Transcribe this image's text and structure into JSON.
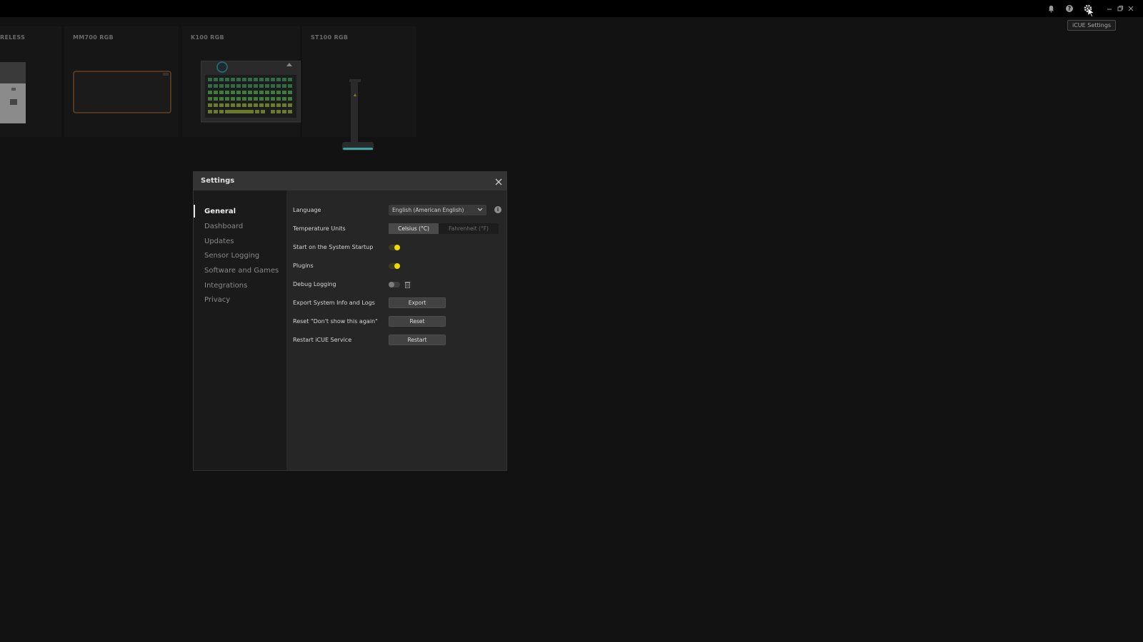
{
  "titlebar": {
    "icons": [
      "bell-icon",
      "help-icon",
      "gear-icon",
      "minimize-icon",
      "restore-icon",
      "close-icon"
    ],
    "tooltip": "iCUE Settings"
  },
  "devices": [
    {
      "name": "RELESS",
      "image": "headset-dongle"
    },
    {
      "name": "MM700 RGB",
      "image": "mousepad"
    },
    {
      "name": "K100 RGB",
      "image": "keyboard"
    },
    {
      "name": "ST100 RGB",
      "image": "headset-stand"
    }
  ],
  "settings": {
    "title": "Settings",
    "nav": [
      {
        "label": "General",
        "active": true
      },
      {
        "label": "Dashboard",
        "active": false
      },
      {
        "label": "Updates",
        "active": false
      },
      {
        "label": "Sensor Logging",
        "active": false
      },
      {
        "label": "Software and Games",
        "active": false
      },
      {
        "label": "Integrations",
        "active": false
      },
      {
        "label": "Privacy",
        "active": false
      }
    ],
    "rows": {
      "language": {
        "label": "Language",
        "value": "English (American English)"
      },
      "temperature": {
        "label": "Temperature Units",
        "options": [
          "Celsius (°C)",
          "Fahrenheit (°F)"
        ],
        "selected": "Celsius (°C)"
      },
      "startup": {
        "label": "Start on the System Startup",
        "on": true
      },
      "plugins": {
        "label": "Plugins",
        "on": true
      },
      "debug": {
        "label": "Debug Logging",
        "on": false
      },
      "export": {
        "label": "Export System Info and Logs",
        "button": "Export"
      },
      "reset": {
        "label": "Reset \"Don't show this again\"",
        "button": "Reset"
      },
      "restart": {
        "label": "Restart iCUE Service",
        "button": "Restart"
      }
    }
  },
  "colors": {
    "accent": "#f1d900",
    "background": "#121212",
    "modal": "#232323"
  }
}
